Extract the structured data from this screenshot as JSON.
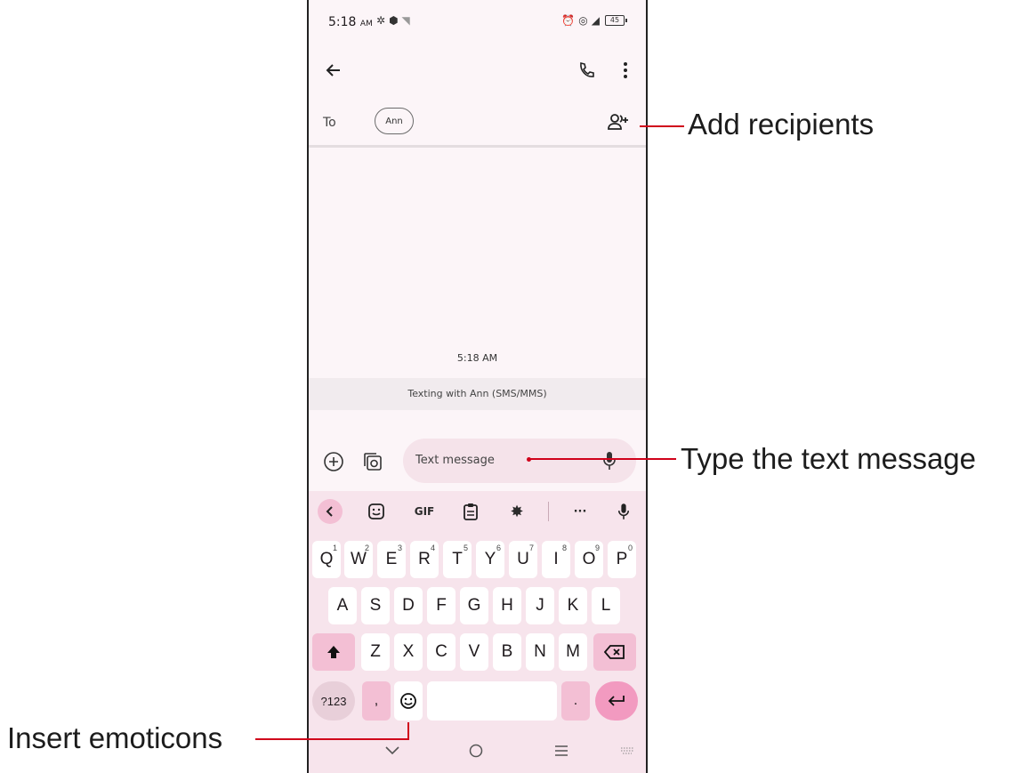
{
  "status_bar": {
    "time": "5:18",
    "ampm": "AM",
    "battery": "45"
  },
  "recipients": {
    "to_label": "To",
    "chip": "Ann"
  },
  "conversation": {
    "timestamp": "5:18 AM",
    "texting_with": "Texting with Ann (SMS/MMS)"
  },
  "compose": {
    "placeholder": "Text message"
  },
  "keyboard": {
    "toolbar": {
      "gif": "GIF",
      "more": "···"
    },
    "row1": [
      {
        "k": "Q",
        "n": "1"
      },
      {
        "k": "W",
        "n": "2"
      },
      {
        "k": "E",
        "n": "3"
      },
      {
        "k": "R",
        "n": "4"
      },
      {
        "k": "T",
        "n": "5"
      },
      {
        "k": "Y",
        "n": "6"
      },
      {
        "k": "U",
        "n": "7"
      },
      {
        "k": "I",
        "n": "8"
      },
      {
        "k": "O",
        "n": "9"
      },
      {
        "k": "P",
        "n": "0"
      }
    ],
    "row2": [
      "A",
      "S",
      "D",
      "F",
      "G",
      "H",
      "J",
      "K",
      "L"
    ],
    "row3": [
      "Z",
      "X",
      "C",
      "V",
      "B",
      "N",
      "M"
    ],
    "symbols": "?123",
    "comma": ",",
    "period": "."
  },
  "annotations": {
    "add_recipients": "Add recipients",
    "type_text": "Type the text message",
    "insert_emoticons": "Insert emoticons"
  },
  "colors": {
    "annotation_line": "#d0021b",
    "keyboard_bg": "#f7e4ec",
    "accent_key": "#f3bfd4"
  }
}
